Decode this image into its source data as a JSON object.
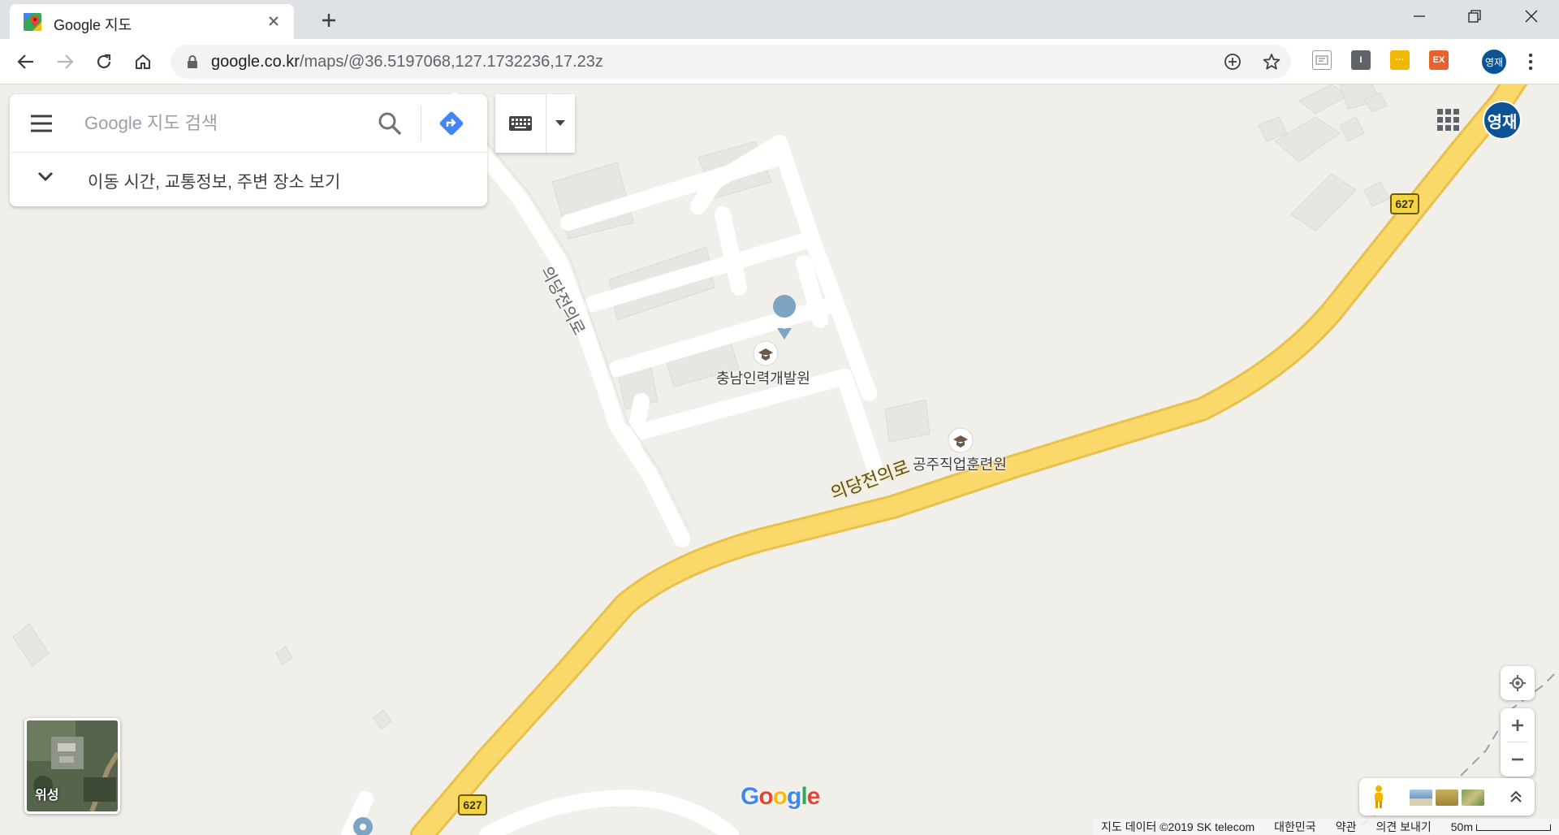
{
  "browser": {
    "tab_title": "Google 지도",
    "url_host": "google.co.kr",
    "url_path": "/maps/@36.5197068,127.1732236,17.23z",
    "profile_initials": "영재"
  },
  "search": {
    "placeholder": "Google 지도 검색",
    "expander_label": "이동 시간, 교통정보, 주변 장소 보기"
  },
  "account": {
    "initials": "영재"
  },
  "map": {
    "pois": [
      {
        "name": "충남인력개발원"
      },
      {
        "name": "공주직업훈련원"
      }
    ],
    "road_main_label": "의당전의로",
    "road_side_label": "의당전의로",
    "route_number": "627"
  },
  "satellite_toggle": {
    "label": "위성"
  },
  "attribution": {
    "data": "지도 데이터 ©2019 SK telecom",
    "country": "대한민국",
    "terms": "약관",
    "feedback": "의견 보내기",
    "scale": "50m"
  },
  "colors": {
    "map_bg": "#f1efea",
    "road_major": "#f8d45f",
    "road_minor": "#ffffff",
    "accent_blue": "#4285f4"
  }
}
